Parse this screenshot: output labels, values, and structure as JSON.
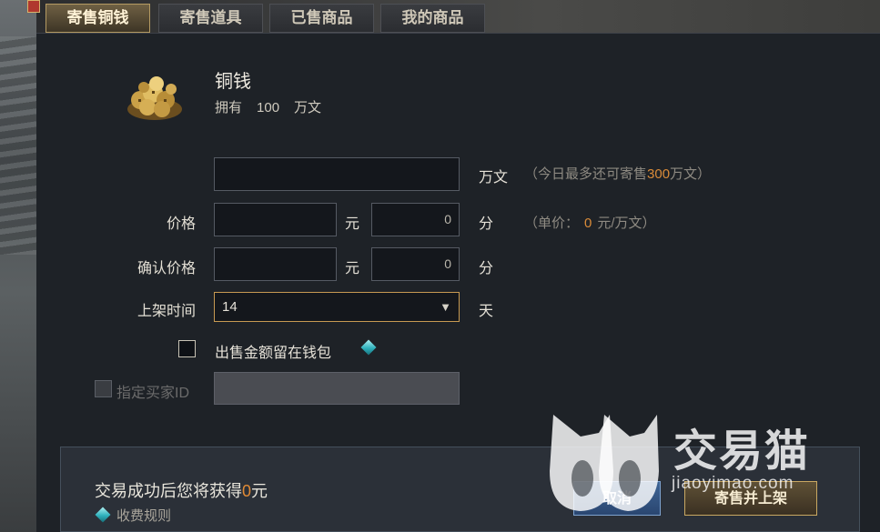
{
  "tabs": [
    {
      "label": "寄售铜钱",
      "active": true
    },
    {
      "label": "寄售道具",
      "active": false
    },
    {
      "label": "已售商品",
      "active": false
    },
    {
      "label": "我的商品",
      "active": false
    }
  ],
  "item": {
    "name": "铜钱",
    "owned_label": "拥有",
    "owned_value": "100",
    "owned_unit": "万文"
  },
  "form": {
    "amount_unit": "万文",
    "amount_hint_pre": "（今日最多还可寄售",
    "amount_hint_value": "300",
    "amount_hint_post": "万文）",
    "price_label": "价格",
    "price_yuan_unit": "元",
    "price_fen_value": "0",
    "price_fen_unit": "分",
    "unit_price_hint_pre": "（单价：",
    "unit_price_hint_value": "0",
    "unit_price_hint_post": "元/万文）",
    "confirm_price_label": "确认价格",
    "confirm_yuan_unit": "元",
    "confirm_fen_value": "0",
    "confirm_fen_unit": "分",
    "listing_time_label": "上架时间",
    "listing_time_value": "14",
    "listing_time_unit": "天",
    "keep_in_wallet_label": "出售金额留在钱包",
    "buyer_id_label": "指定买家ID"
  },
  "footer": {
    "gain_pre": "交易成功后您将获得",
    "gain_value": "0",
    "gain_post": "元",
    "fee_rule_label": "收费规则",
    "cancel_label": "取消",
    "list_label": "寄售并上架"
  },
  "watermark": {
    "text": "交易猫",
    "url": "jiaoyimao.com"
  },
  "colors": {
    "accent_orange": "#d98b39",
    "gold_border": "#c79a52",
    "cancel_blue": "#3f6596"
  },
  "icons": [
    "coin-pile-icon",
    "info-diamond-icon",
    "dropdown-caret-icon",
    "cat-logo-icon"
  ]
}
